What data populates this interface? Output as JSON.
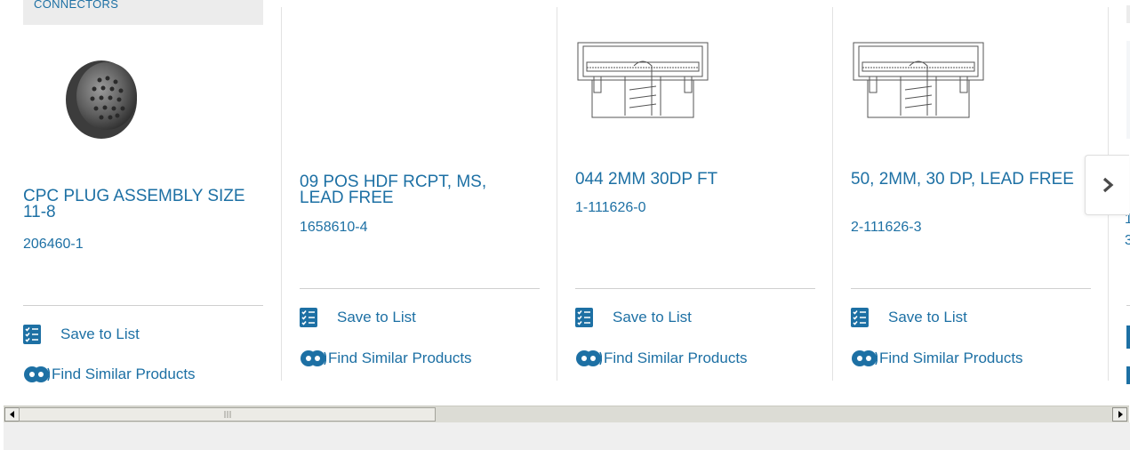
{
  "cards": [
    {
      "category": "CONNECTORS",
      "title": "CPC PLUG ASSEMBLY SIZE 11-8",
      "part_number": "206460-1",
      "save_label": "Save to List",
      "similar_label": "Find Similar Products"
    },
    {
      "title": "09 POS HDF RCPT, MS, LEAD FREE",
      "part_number": "1658610-4",
      "save_label": "Save to List",
      "similar_label": "Find Similar Products"
    },
    {
      "title": "044 2MM 30DP FT",
      "part_number": "1-111626-0",
      "save_label": "Save to List",
      "similar_label": "Find Similar Products"
    },
    {
      "title": "50, 2MM, 30 DP, LEAD FREE",
      "part_number": "2-111626-3",
      "save_label": "Save to List",
      "similar_label": "Find Similar Products"
    }
  ],
  "partial_card": {
    "title": "1",
    "part_number": "3"
  },
  "colors": {
    "link": "#1d70a4",
    "icon_bg": "#1d70a4"
  },
  "icons": {
    "save": "checklist-icon",
    "similar": "gears-icon",
    "next": "chevron-right-icon"
  }
}
